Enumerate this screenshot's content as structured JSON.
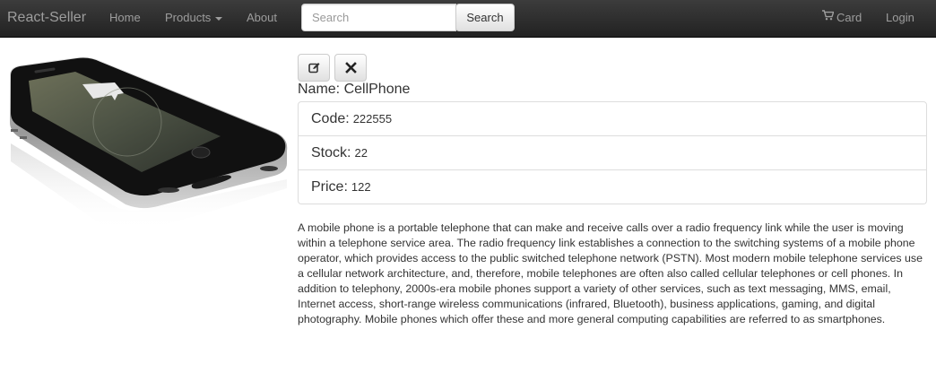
{
  "navbar": {
    "brand": "React-Seller",
    "links": [
      {
        "label": "Home"
      },
      {
        "label": "Products"
      },
      {
        "label": "About"
      }
    ],
    "search": {
      "placeholder": "Search",
      "button_label": "Search"
    },
    "cart_label": "Card",
    "login_label": "Login"
  },
  "product": {
    "name_text": "Name: CellPhone",
    "fields": [
      {
        "label": "Code:",
        "value": "222555"
      },
      {
        "label": "Stock:",
        "value": "22"
      },
      {
        "label": "Price:",
        "value": "122"
      }
    ],
    "description": "A mobile phone is a portable telephone that can make and receive calls over a radio frequency link while the user is moving within a telephone service area. The radio frequency link establishes a connection to the switching systems of a mobile phone operator, which provides access to the public switched telephone network (PSTN). Most modern mobile telephone services use a cellular network architecture, and, therefore, mobile telephones are often also called cellular telephones or cell phones. In addition to telephony, 2000s-era mobile phones support a variety of other services, such as text messaging, MMS, email, Internet access, short-range wireless communications (infrared, Bluetooth), business applications, gaming, and digital photography. Mobile phones which offer these and more general computing capabilities are referred to as smartphones."
  },
  "icons": {
    "edit": "edit-icon",
    "delete": "close-icon",
    "cart": "shopping-cart-icon"
  }
}
